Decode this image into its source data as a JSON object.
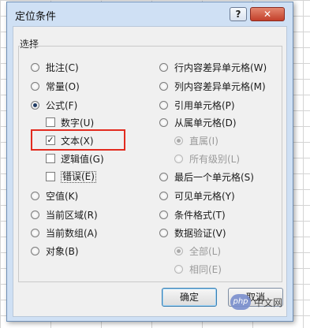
{
  "dialog": {
    "title": "定位条件",
    "help_label": "?",
    "close_label": "✕",
    "group_label": "选择"
  },
  "left_options": [
    {
      "label": "批注(C)",
      "type": "radio",
      "checked": false
    },
    {
      "label": "常量(O)",
      "type": "radio",
      "checked": false
    },
    {
      "label": "公式(F)",
      "type": "radio",
      "checked": true
    },
    {
      "label": "数字(U)",
      "type": "checkbox",
      "checked": false
    },
    {
      "label": "文本(X)",
      "type": "checkbox",
      "checked": true
    },
    {
      "label": "逻辑值(G)",
      "type": "checkbox",
      "checked": false
    },
    {
      "label": "错误(E)",
      "type": "checkbox",
      "checked": false
    },
    {
      "label": "空值(K)",
      "type": "radio",
      "checked": false
    },
    {
      "label": "当前区域(R)",
      "type": "radio",
      "checked": false
    },
    {
      "label": "当前数组(A)",
      "type": "radio",
      "checked": false
    },
    {
      "label": "对象(B)",
      "type": "radio",
      "checked": false
    }
  ],
  "right_options": [
    {
      "label": "行内容差异单元格(W)",
      "checked": false,
      "disabled": false
    },
    {
      "label": "列内容差异单元格(M)",
      "checked": false,
      "disabled": false
    },
    {
      "label": "引用单元格(P)",
      "checked": false,
      "disabled": false
    },
    {
      "label": "从属单元格(D)",
      "checked": false,
      "disabled": false
    },
    {
      "label": "直属(I)",
      "checked": true,
      "disabled": true
    },
    {
      "label": "所有级别(L)",
      "checked": false,
      "disabled": true
    },
    {
      "label": "最后一个单元格(S)",
      "checked": false,
      "disabled": false
    },
    {
      "label": "可见单元格(Y)",
      "checked": false,
      "disabled": false
    },
    {
      "label": "条件格式(T)",
      "checked": false,
      "disabled": false
    },
    {
      "label": "数据验证(V)",
      "checked": false,
      "disabled": false
    },
    {
      "label": "全部(L)",
      "checked": true,
      "disabled": true
    },
    {
      "label": "相同(E)",
      "checked": false,
      "disabled": true
    }
  ],
  "buttons": {
    "ok": "确定",
    "cancel": "取消"
  },
  "watermark": {
    "badge": "php",
    "text": "中文网"
  },
  "colors": {
    "highlight": "#e22b1f",
    "dialog_frame": "#cfe0f4",
    "close_button": "#c3402b"
  }
}
